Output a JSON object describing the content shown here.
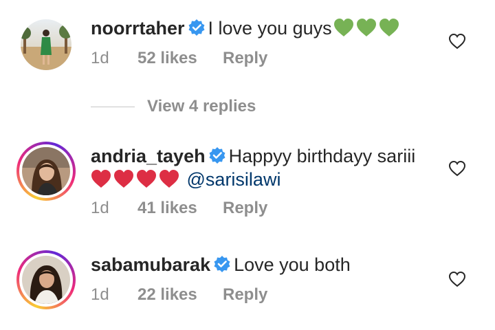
{
  "comments": [
    {
      "username": "noorrtaher",
      "text": "I love you guys",
      "emoji": [
        "green-heart",
        "green-heart",
        "green-heart"
      ],
      "time": "1d",
      "likes": "52 likes",
      "reply": "Reply"
    },
    {
      "username": "andria_tayeh",
      "text": "Happyy birthdayy sariii",
      "emoji": [
        "red-heart",
        "red-heart",
        "red-heart",
        "red-heart"
      ],
      "mention": "@sarisilawi",
      "time": "1d",
      "likes": "41 likes",
      "reply": "Reply"
    },
    {
      "username": "sabamubarak",
      "text": "Love you both",
      "time": "1d",
      "likes": "22 likes",
      "reply": "Reply"
    }
  ],
  "view_replies": "View 4 replies",
  "colors": {
    "verified": "#3897f0",
    "green_heart": "#77b255",
    "red_heart": "#dd2e44",
    "meta_gray": "#8e8e8e",
    "mention_blue": "#00376b"
  },
  "icons": {
    "verified": "verified-badge-icon",
    "like": "heart-outline-icon"
  }
}
